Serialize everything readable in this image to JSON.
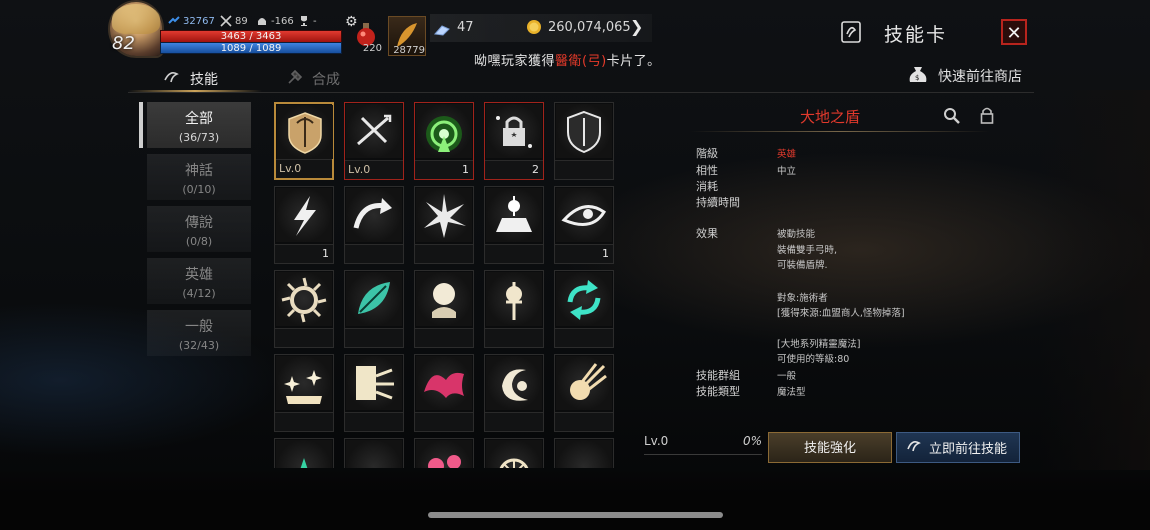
{
  "hud": {
    "level": "82",
    "power": "32767",
    "stat_attack": "89",
    "stat_defense": "-166",
    "trophy": "-",
    "hp": "3463 / 3463",
    "mp": "1089 / 1089",
    "potion_count": "220",
    "slot_count": "28779",
    "crystals": "47",
    "gold": "260,074,065",
    "notice_prefix": "呦嘿玩家獲得",
    "notice_highlight": "醫衛(弓)",
    "notice_suffix": "卡片了。"
  },
  "window": {
    "title": "技能卡",
    "close_label": "✕"
  },
  "tabs": [
    {
      "label": "技能",
      "active": true
    },
    {
      "label": "合成",
      "active": false
    }
  ],
  "shop_link": "快速前往商店",
  "categories": [
    {
      "title": "全部",
      "count": "(36/73)",
      "active": true
    },
    {
      "title": "神話",
      "count": "(0/10)",
      "active": false
    },
    {
      "title": "傳說",
      "count": "(0/8)",
      "active": false
    },
    {
      "title": "英雄",
      "count": "(4/12)",
      "active": false
    },
    {
      "title": "一般",
      "count": "(32/43)",
      "active": false
    }
  ],
  "grid": [
    {
      "icon": "bow-shield-icon",
      "border": "gold",
      "lv": "Lv.0",
      "count": ""
    },
    {
      "icon": "crossed-arrows-icon",
      "border": "red",
      "lv": "Lv.0",
      "count": ""
    },
    {
      "icon": "signal-tower-icon",
      "border": "red",
      "lv": "",
      "count": "1"
    },
    {
      "icon": "lock-star-icon",
      "border": "red",
      "lv": "",
      "count": "2"
    },
    {
      "icon": "shield-icon",
      "border": "none",
      "lv": "",
      "count": ""
    },
    {
      "icon": "lightning-icon",
      "border": "none",
      "lv": "",
      "count": "1"
    },
    {
      "icon": "curved-arrow-icon",
      "border": "none",
      "lv": "",
      "count": ""
    },
    {
      "icon": "burst-icon",
      "border": "none",
      "lv": "",
      "count": ""
    },
    {
      "icon": "altar-light-icon",
      "border": "none",
      "lv": "",
      "count": ""
    },
    {
      "icon": "eye-icon",
      "border": "none",
      "lv": "",
      "count": "1"
    },
    {
      "icon": "spiky-sun-icon",
      "border": "none",
      "lv": "",
      "count": ""
    },
    {
      "icon": "heal-leaf-icon",
      "border": "none",
      "lv": "",
      "count": ""
    },
    {
      "icon": "orb-pedestal-icon",
      "border": "none",
      "lv": "",
      "count": ""
    },
    {
      "icon": "sword-orb-icon",
      "border": "none",
      "lv": "",
      "count": ""
    },
    {
      "icon": "refresh-icon",
      "border": "none",
      "lv": "",
      "count": ""
    },
    {
      "icon": "sparkle-crown-icon",
      "border": "none",
      "lv": "",
      "count": ""
    },
    {
      "icon": "card-break-icon",
      "border": "none",
      "lv": "",
      "count": ""
    },
    {
      "icon": "bat-wing-icon",
      "border": "none",
      "lv": "",
      "count": ""
    },
    {
      "icon": "crescent-icon",
      "border": "none",
      "lv": "",
      "count": ""
    },
    {
      "icon": "fireball-icon",
      "border": "none",
      "lv": "",
      "count": ""
    },
    {
      "icon": "green-burst-icon",
      "border": "none",
      "lv": "",
      "count": ""
    },
    {
      "icon": "green-sparkle-icon",
      "border": "none",
      "lv": "",
      "count": ""
    },
    {
      "icon": "pink-flower-icon",
      "border": "none",
      "lv": "",
      "count": ""
    },
    {
      "icon": "wheel-icon",
      "border": "none",
      "lv": "",
      "count": ""
    },
    {
      "icon": "flame-grass-icon",
      "border": "none",
      "lv": "",
      "count": ""
    }
  ],
  "detail": {
    "name": "大地之盾",
    "rows": [
      {
        "label": "階級",
        "value": "英雄",
        "red": true
      },
      {
        "label": "相性",
        "value": "中立"
      },
      {
        "label": "消耗",
        "value": ""
      },
      {
        "label": "持續時間",
        "value": ""
      }
    ],
    "effect_label": "效果",
    "effect_lines": [
      "被動技能",
      "裝備雙手弓時,",
      "可裝備盾牌.",
      "",
      "對象:施術者",
      "[獲得來源:血盟商人,怪物掉落]",
      "",
      "[大地系列精靈魔法]",
      "可使用的等級:80"
    ],
    "group_label": "技能群組",
    "group_value": "一般",
    "type_label": "技能類型",
    "type_value": "魔法型"
  },
  "footer": {
    "lv": "Lv.0",
    "pct": "0%",
    "enhance": "技能強化",
    "goto": "立即前往技能"
  }
}
